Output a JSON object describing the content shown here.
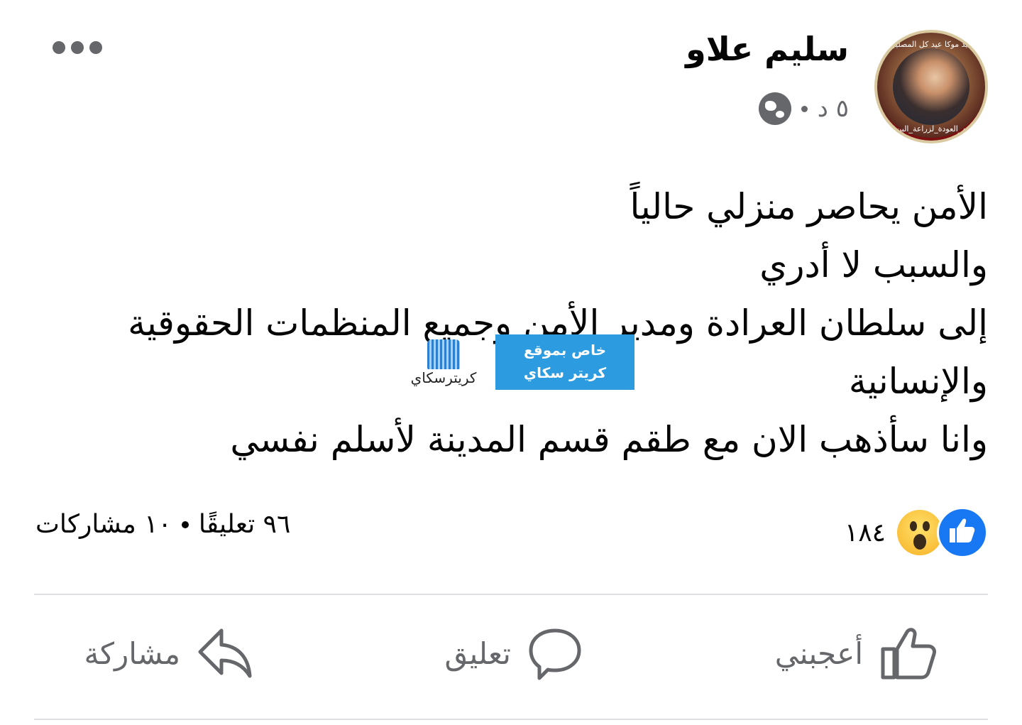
{
  "author": {
    "name": "سليم علاو",
    "time": "٥ د"
  },
  "avatar": {
    "top_text": "عيد موكا عيد كل المصلين",
    "bottom_text": "#يوم_العودة_لزراعة_البن"
  },
  "post": {
    "lines": [
      "الأمن يحاصر منزلي حالياً",
      "والسبب لا أدري",
      "إلى سلطان العرادة ومدير الأمن وجميع المنظمات الحقوقية",
      "والإنسانية",
      "وانا سأذهب الان مع طقم قسم المدينة لأسلم نفسي"
    ]
  },
  "watermark": {
    "line1": "خاص بموقع",
    "line2": "كريتر سكاي",
    "logo_text": "كريترسكاي"
  },
  "stats": {
    "reactions_count": "١٨٤",
    "comments": "٩٦ تعليقًا",
    "shares": "١٠ مشاركات"
  },
  "actions": {
    "like": "أعجبني",
    "comment": "تعليق",
    "share": "مشاركة"
  },
  "colors": {
    "like_blue": "#1877f2",
    "muted": "#65676b",
    "watermark_bg": "#2d9be0"
  },
  "icons": [
    "globe-icon",
    "more-icon",
    "like-reaction-icon",
    "wow-reaction-icon",
    "thumbs-up-icon",
    "comment-icon",
    "share-icon"
  ]
}
